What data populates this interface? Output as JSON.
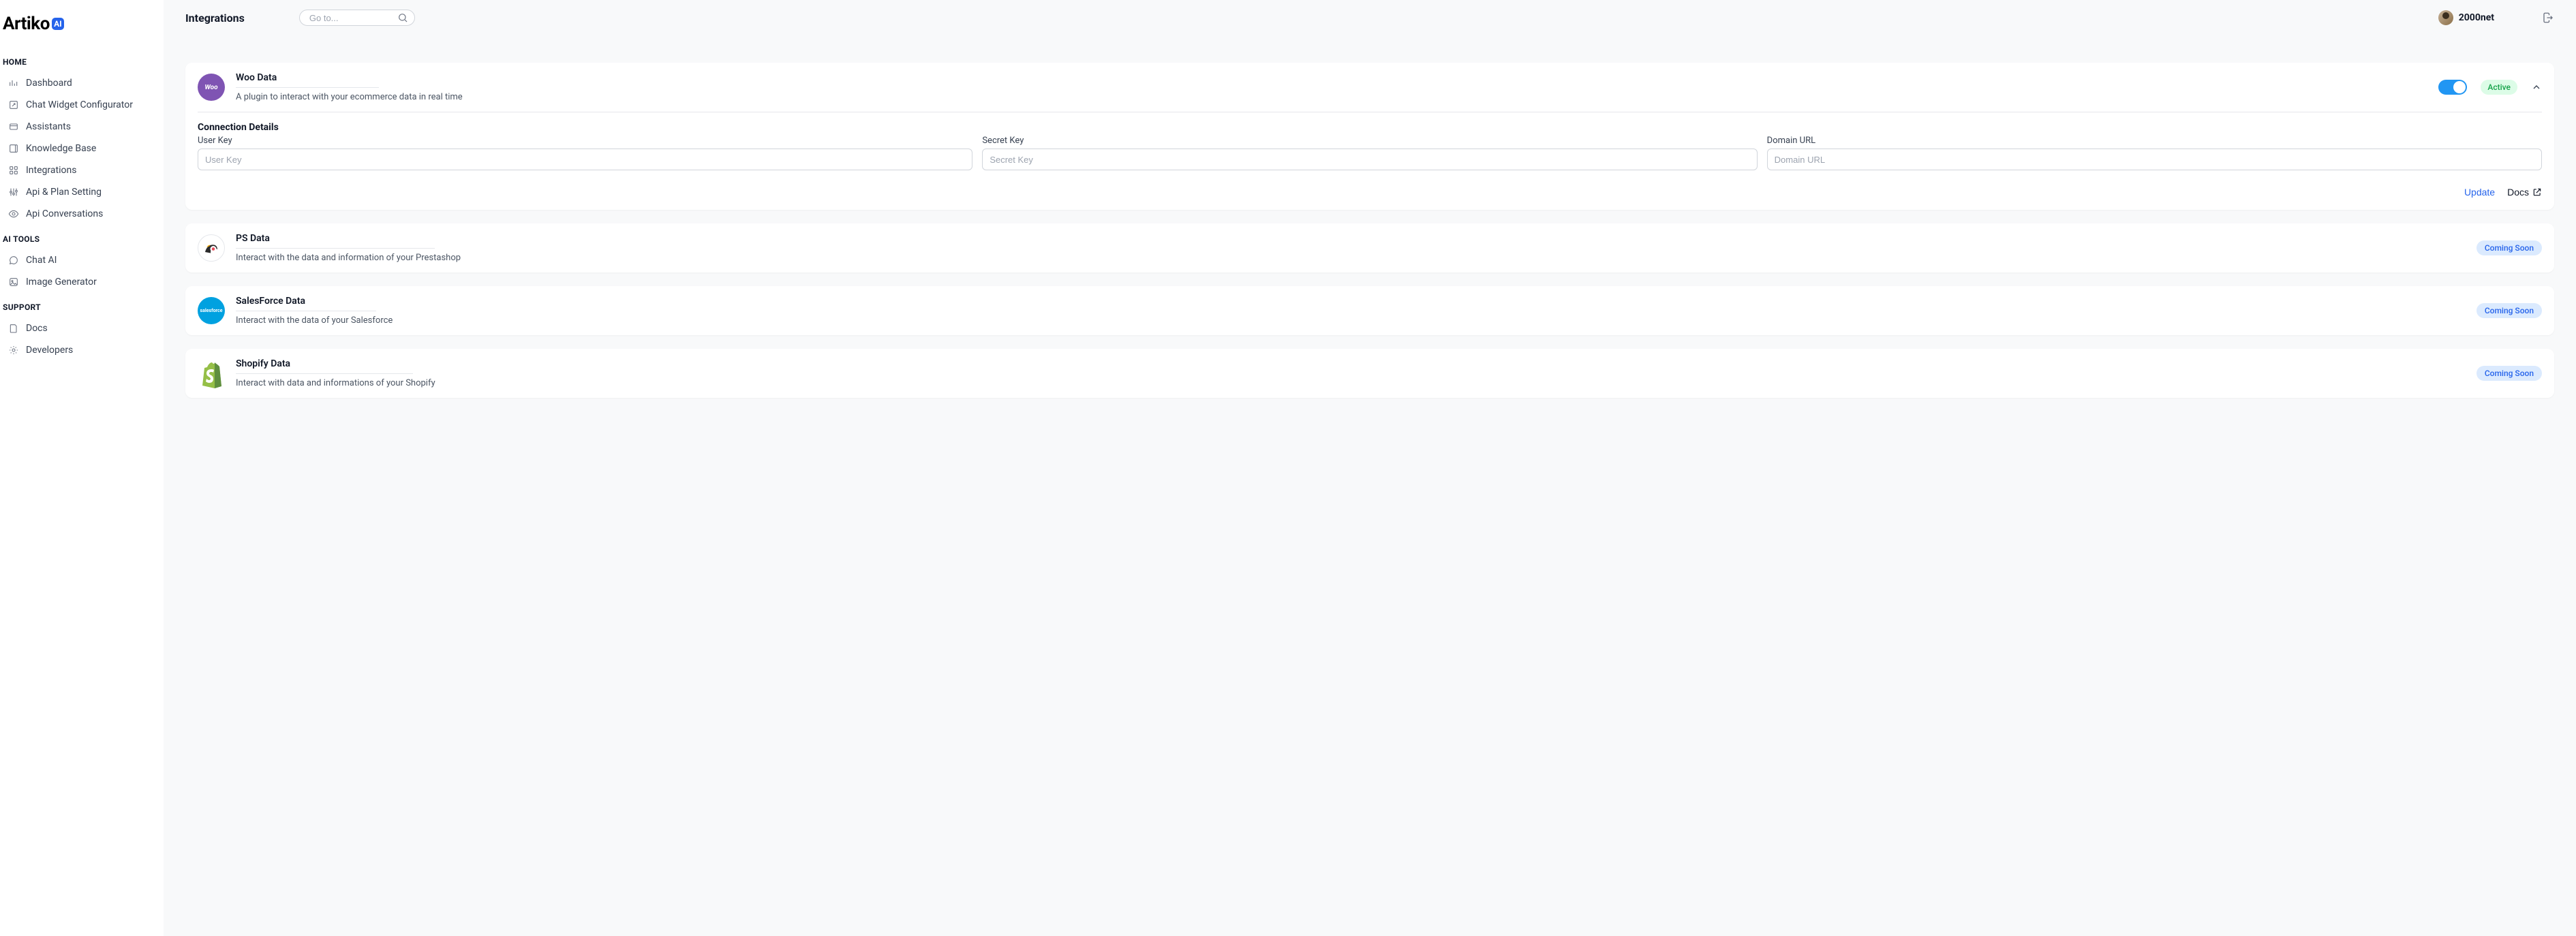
{
  "brand": {
    "name": "Artiko",
    "badge": "AI"
  },
  "sidebar": {
    "sections": [
      {
        "title": "HOME",
        "items": [
          {
            "label": "Dashboard"
          },
          {
            "label": "Chat Widget Configurator"
          },
          {
            "label": "Assistants"
          },
          {
            "label": "Knowledge Base"
          },
          {
            "label": "Integrations"
          },
          {
            "label": "Api & Plan Setting"
          },
          {
            "label": "Api Conversations"
          }
        ]
      },
      {
        "title": "AI TOOLS",
        "items": [
          {
            "label": "Chat AI"
          },
          {
            "label": "Image Generator"
          }
        ]
      },
      {
        "title": "SUPPORT",
        "items": [
          {
            "label": "Docs"
          },
          {
            "label": "Developers"
          }
        ]
      }
    ]
  },
  "header": {
    "title": "Integrations",
    "search_placeholder": "Go to...",
    "user_name": "2000net"
  },
  "integrations": {
    "woo": {
      "title": "Woo Data",
      "desc": "A plugin to interact with your ecommerce data in real time",
      "logo_text": "Woo",
      "status_label": "Active",
      "connection_title": "Connection Details",
      "fields": {
        "user_key": {
          "label": "User Key",
          "placeholder": "User Key"
        },
        "secret_key": {
          "label": "Secret Key",
          "placeholder": "Secret Key"
        },
        "domain_url": {
          "label": "Domain URL",
          "placeholder": "Domain URL"
        }
      },
      "update_label": "Update",
      "docs_label": "Docs"
    },
    "ps": {
      "title": "PS Data",
      "desc": "Interact with the data and information of your Prestashop",
      "status_label": "Coming Soon"
    },
    "sf": {
      "title": "SalesForce Data",
      "desc": "Interact with the data of your Salesforce",
      "logo_text": "salesforce",
      "status_label": "Coming Soon"
    },
    "shopify": {
      "title": "Shopify Data",
      "desc": "Interact with data and informations of your Shopify",
      "status_label": "Coming Soon"
    }
  }
}
